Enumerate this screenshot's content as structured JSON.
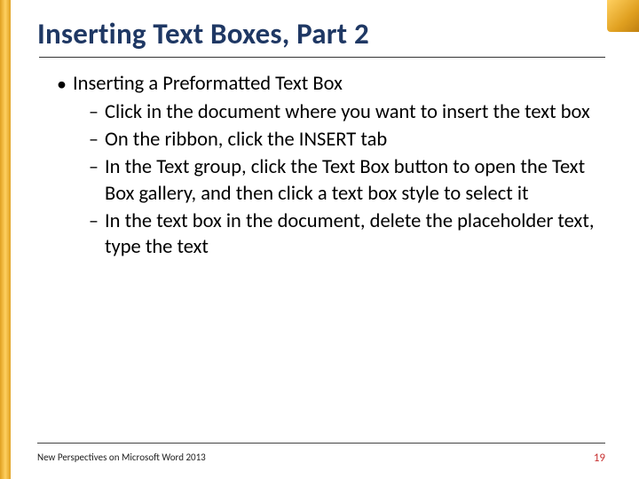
{
  "title": "Inserting Text Boxes, Part 2",
  "bullets": {
    "l1": "Inserting a Preformatted Text Box",
    "l2": [
      "Click in the document where you want to insert the text box",
      "On the ribbon, click the INSERT tab",
      "In the Text group, click the Text Box button to open the Text Box gallery, and then click a text box style to select it",
      "In the text box in the document, delete the placeholder text, type the text"
    ]
  },
  "footer": {
    "left": "New Perspectives on Microsoft Word 2013",
    "page": "19"
  }
}
